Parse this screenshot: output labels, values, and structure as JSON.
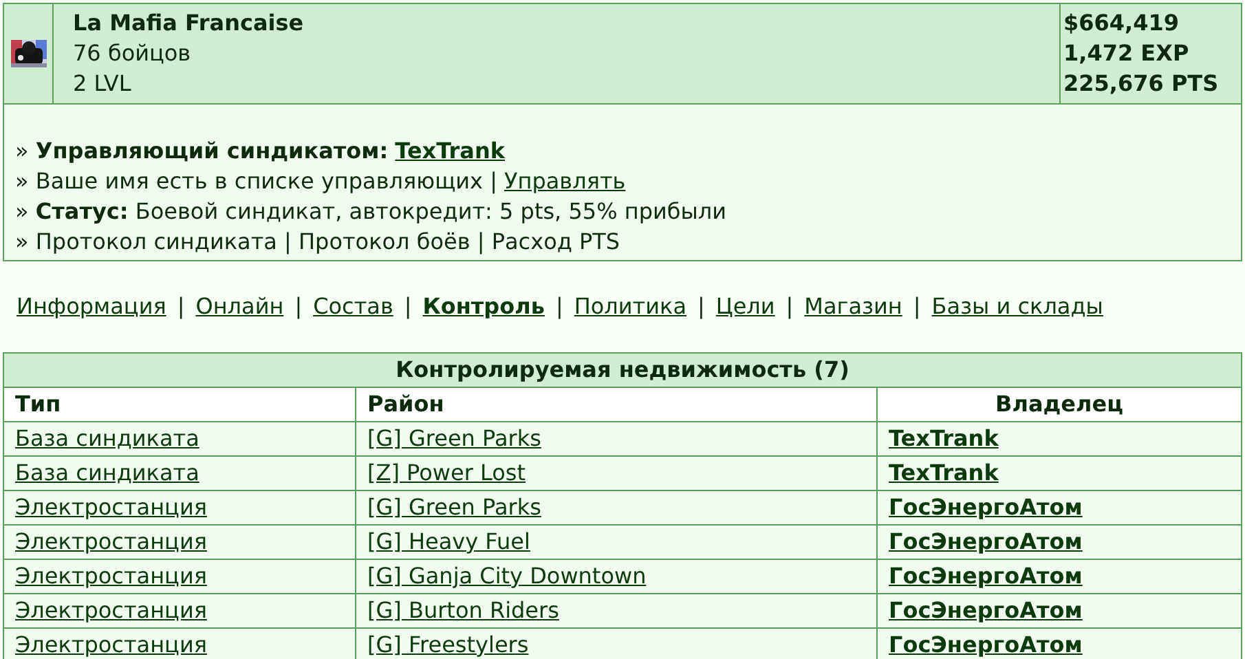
{
  "syndicate": {
    "emblem": {
      "kind": "picture"
    },
    "name": "La Mafia Francaise",
    "fighters": "76 бойцов",
    "level": "2 LVL",
    "stats": [
      "$664,419",
      "1,472 EXP",
      "225,676 PTS"
    ]
  },
  "info_lines": [
    {
      "text": "» **Управляющий синдикатом:**",
      "link": "TexTrank"
    },
    {
      "text": "» Ваше имя есть в списке управляющих |",
      "link": "Управлять"
    },
    {
      "text": "» **Статус:** Боевой синдикат, автокредит: 5 pts, 55% прибыли"
    },
    {
      "text": "» Протокол синдиката | Протокол боёв | Расход PTS"
    }
  ],
  "nav_separator": "|",
  "nav": [
    {
      "label": "Информация",
      "selected": false
    },
    {
      "label": "Онлайн",
      "selected": false
    },
    {
      "label": "Состав",
      "selected": false
    },
    {
      "label": "Контроль",
      "selected": true
    },
    {
      "label": "Политика",
      "selected": false
    },
    {
      "label": "Цели",
      "selected": false
    },
    {
      "label": "Магазин",
      "selected": false
    },
    {
      "label": "Базы и склады",
      "selected": false
    }
  ],
  "table": {
    "title": "Контролируемая недвижимость (7)",
    "columns": [
      "Тип",
      "Район",
      "Владелец"
    ],
    "rows": [
      [
        "База синдиката",
        "[G] Green Parks",
        "TexTrank"
      ],
      [
        "База синдиката",
        "[Z] Power Lost",
        "TexTrank"
      ],
      [
        "Электростанция",
        "[G] Green Parks",
        "ГосЭнергоАтом"
      ],
      [
        "Электростанция",
        "[G] Heavy Fuel",
        "ГосЭнергоАтом"
      ],
      [
        "Электростанция",
        "[G] Ganja City Downtown",
        "ГосЭнергоАтом"
      ],
      [
        "Электростанция",
        "[G] Burton Riders",
        "ГосЭнергоАтом"
      ],
      [
        "Электростанция",
        "[G] Freestylers",
        "ГосЭнергоАтом"
      ]
    ]
  }
}
